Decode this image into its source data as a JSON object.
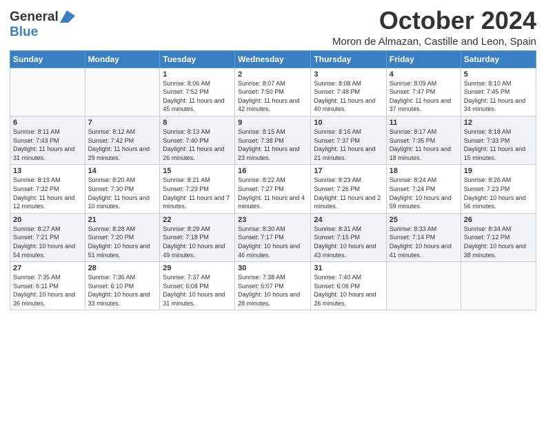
{
  "header": {
    "logo_general": "General",
    "logo_blue": "Blue",
    "month_title": "October 2024",
    "location": "Moron de Almazan, Castille and Leon, Spain"
  },
  "weekdays": [
    "Sunday",
    "Monday",
    "Tuesday",
    "Wednesday",
    "Thursday",
    "Friday",
    "Saturday"
  ],
  "weeks": [
    [
      {
        "day": "",
        "sunrise": "",
        "sunset": "",
        "daylight": ""
      },
      {
        "day": "",
        "sunrise": "",
        "sunset": "",
        "daylight": ""
      },
      {
        "day": "1",
        "sunrise": "Sunrise: 8:06 AM",
        "sunset": "Sunset: 7:52 PM",
        "daylight": "Daylight: 11 hours and 45 minutes."
      },
      {
        "day": "2",
        "sunrise": "Sunrise: 8:07 AM",
        "sunset": "Sunset: 7:50 PM",
        "daylight": "Daylight: 11 hours and 42 minutes."
      },
      {
        "day": "3",
        "sunrise": "Sunrise: 8:08 AM",
        "sunset": "Sunset: 7:48 PM",
        "daylight": "Daylight: 11 hours and 40 minutes."
      },
      {
        "day": "4",
        "sunrise": "Sunrise: 8:09 AM",
        "sunset": "Sunset: 7:47 PM",
        "daylight": "Daylight: 11 hours and 37 minutes."
      },
      {
        "day": "5",
        "sunrise": "Sunrise: 8:10 AM",
        "sunset": "Sunset: 7:45 PM",
        "daylight": "Daylight: 11 hours and 34 minutes."
      }
    ],
    [
      {
        "day": "6",
        "sunrise": "Sunrise: 8:11 AM",
        "sunset": "Sunset: 7:43 PM",
        "daylight": "Daylight: 11 hours and 31 minutes."
      },
      {
        "day": "7",
        "sunrise": "Sunrise: 8:12 AM",
        "sunset": "Sunset: 7:42 PM",
        "daylight": "Daylight: 11 hours and 29 minutes."
      },
      {
        "day": "8",
        "sunrise": "Sunrise: 8:13 AM",
        "sunset": "Sunset: 7:40 PM",
        "daylight": "Daylight: 11 hours and 26 minutes."
      },
      {
        "day": "9",
        "sunrise": "Sunrise: 8:15 AM",
        "sunset": "Sunset: 7:38 PM",
        "daylight": "Daylight: 11 hours and 23 minutes."
      },
      {
        "day": "10",
        "sunrise": "Sunrise: 8:16 AM",
        "sunset": "Sunset: 7:37 PM",
        "daylight": "Daylight: 11 hours and 21 minutes."
      },
      {
        "day": "11",
        "sunrise": "Sunrise: 8:17 AM",
        "sunset": "Sunset: 7:35 PM",
        "daylight": "Daylight: 11 hours and 18 minutes."
      },
      {
        "day": "12",
        "sunrise": "Sunrise: 8:18 AM",
        "sunset": "Sunset: 7:33 PM",
        "daylight": "Daylight: 11 hours and 15 minutes."
      }
    ],
    [
      {
        "day": "13",
        "sunrise": "Sunrise: 8:19 AM",
        "sunset": "Sunset: 7:32 PM",
        "daylight": "Daylight: 11 hours and 12 minutes."
      },
      {
        "day": "14",
        "sunrise": "Sunrise: 8:20 AM",
        "sunset": "Sunset: 7:30 PM",
        "daylight": "Daylight: 11 hours and 10 minutes."
      },
      {
        "day": "15",
        "sunrise": "Sunrise: 8:21 AM",
        "sunset": "Sunset: 7:29 PM",
        "daylight": "Daylight: 11 hours and 7 minutes."
      },
      {
        "day": "16",
        "sunrise": "Sunrise: 8:22 AM",
        "sunset": "Sunset: 7:27 PM",
        "daylight": "Daylight: 11 hours and 4 minutes."
      },
      {
        "day": "17",
        "sunrise": "Sunrise: 8:23 AM",
        "sunset": "Sunset: 7:26 PM",
        "daylight": "Daylight: 11 hours and 2 minutes."
      },
      {
        "day": "18",
        "sunrise": "Sunrise: 8:24 AM",
        "sunset": "Sunset: 7:24 PM",
        "daylight": "Daylight: 10 hours and 59 minutes."
      },
      {
        "day": "19",
        "sunrise": "Sunrise: 8:26 AM",
        "sunset": "Sunset: 7:23 PM",
        "daylight": "Daylight: 10 hours and 56 minutes."
      }
    ],
    [
      {
        "day": "20",
        "sunrise": "Sunrise: 8:27 AM",
        "sunset": "Sunset: 7:21 PM",
        "daylight": "Daylight: 10 hours and 54 minutes."
      },
      {
        "day": "21",
        "sunrise": "Sunrise: 8:28 AM",
        "sunset": "Sunset: 7:20 PM",
        "daylight": "Daylight: 10 hours and 51 minutes."
      },
      {
        "day": "22",
        "sunrise": "Sunrise: 8:29 AM",
        "sunset": "Sunset: 7:18 PM",
        "daylight": "Daylight: 10 hours and 49 minutes."
      },
      {
        "day": "23",
        "sunrise": "Sunrise: 8:30 AM",
        "sunset": "Sunset: 7:17 PM",
        "daylight": "Daylight: 10 hours and 46 minutes."
      },
      {
        "day": "24",
        "sunrise": "Sunrise: 8:31 AM",
        "sunset": "Sunset: 7:15 PM",
        "daylight": "Daylight: 10 hours and 43 minutes."
      },
      {
        "day": "25",
        "sunrise": "Sunrise: 8:33 AM",
        "sunset": "Sunset: 7:14 PM",
        "daylight": "Daylight: 10 hours and 41 minutes."
      },
      {
        "day": "26",
        "sunrise": "Sunrise: 8:34 AM",
        "sunset": "Sunset: 7:12 PM",
        "daylight": "Daylight: 10 hours and 38 minutes."
      }
    ],
    [
      {
        "day": "27",
        "sunrise": "Sunrise: 7:35 AM",
        "sunset": "Sunset: 6:11 PM",
        "daylight": "Daylight: 10 hours and 36 minutes."
      },
      {
        "day": "28",
        "sunrise": "Sunrise: 7:36 AM",
        "sunset": "Sunset: 6:10 PM",
        "daylight": "Daylight: 10 hours and 33 minutes."
      },
      {
        "day": "29",
        "sunrise": "Sunrise: 7:37 AM",
        "sunset": "Sunset: 6:08 PM",
        "daylight": "Daylight: 10 hours and 31 minutes."
      },
      {
        "day": "30",
        "sunrise": "Sunrise: 7:38 AM",
        "sunset": "Sunset: 6:07 PM",
        "daylight": "Daylight: 10 hours and 28 minutes."
      },
      {
        "day": "31",
        "sunrise": "Sunrise: 7:40 AM",
        "sunset": "Sunset: 6:06 PM",
        "daylight": "Daylight: 10 hours and 26 minutes."
      },
      {
        "day": "",
        "sunrise": "",
        "sunset": "",
        "daylight": ""
      },
      {
        "day": "",
        "sunrise": "",
        "sunset": "",
        "daylight": ""
      }
    ]
  ]
}
